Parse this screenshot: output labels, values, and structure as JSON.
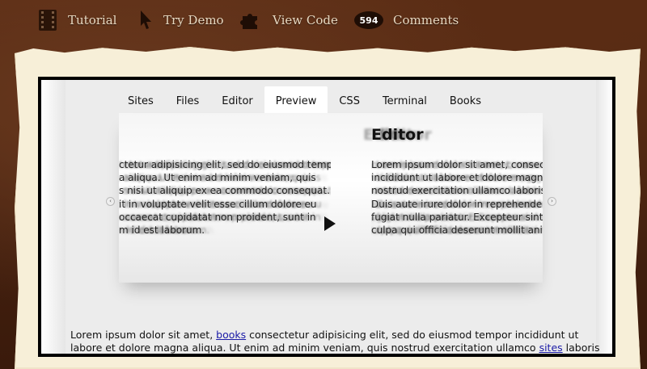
{
  "nav": {
    "tutorial": {
      "label": "Tutorial",
      "icon": "film-icon"
    },
    "try_demo": {
      "label": "Try Demo",
      "icon": "cursor-icon"
    },
    "view_code": {
      "label": "View Code",
      "icon": "puzzle-icon"
    },
    "comments": {
      "label": "Comments",
      "count": "594"
    }
  },
  "demo": {
    "tabs": [
      {
        "label": "Sites"
      },
      {
        "label": "Files"
      },
      {
        "label": "Editor"
      },
      {
        "label": "Preview",
        "active": true
      },
      {
        "label": "CSS"
      },
      {
        "label": "Terminal"
      },
      {
        "label": "Books"
      }
    ],
    "stage_title": "Editor",
    "left_lines": [
      "ctetur adipisicing elit, sed do eiusmod tempor",
      "a aliqua. Ut enim ad minim veniam, quis",
      "s nisi ut aliquip ex ea commodo consequat.",
      "it in voluptate velit esse cillum dolore eu",
      "occaecat cupidatat non proident, sunt in",
      "m id est laborum."
    ],
    "right_lines": [
      "Lorem ipsum dolor sit amet, consec",
      "incididunt ut labore et dolore magn",
      "nostrud exercitation ullamco laboris",
      "Duis aute irure dolor in reprehender",
      "fugiat nulla pariatur. Excepteur sint",
      "culpa qui officia deserunt mollit ani"
    ],
    "arrow_left": "‹",
    "arrow_right": "›"
  },
  "body": {
    "line1_a": "Lorem ipsum dolor sit amet, ",
    "line1_link": "books",
    "line1_b": " consectetur adipisicing elit, sed do eiusmod tempor incididunt ut",
    "line2_a": "labore et dolore magna aliqua. Ut enim ad minim veniam, quis nostrud exercitation ullamco ",
    "line2_link": "sites",
    "line2_b": " laboris"
  }
}
